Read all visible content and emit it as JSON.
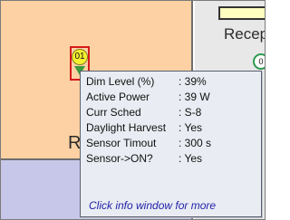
{
  "rooms": {
    "main_label": "R",
    "right_label": "Recep"
  },
  "sensors": [
    {
      "id": "01",
      "status_color": "#f6f02f"
    },
    {
      "id": "0",
      "status_color": "#ffffff"
    }
  ],
  "info_window": {
    "rows": [
      {
        "key": "Dim Level (%)",
        "value": ": 39%"
      },
      {
        "key": "Active Power",
        "value": ": 39 W"
      },
      {
        "key": "Curr Sched",
        "value": ": S-8"
      },
      {
        "key": "Daylight Harvest",
        "value": ": Yes"
      },
      {
        "key": "Sensor Timout",
        "value": ": 300 s"
      },
      {
        "key": "Sensor->ON?",
        "value": ": Yes"
      }
    ],
    "link_text": "Click info window for more"
  },
  "colors": {
    "main_room": "#fdd1a3",
    "bottom_room": "#c7c7e9",
    "selected_border": "#d41a1a",
    "link": "#2222aa"
  }
}
